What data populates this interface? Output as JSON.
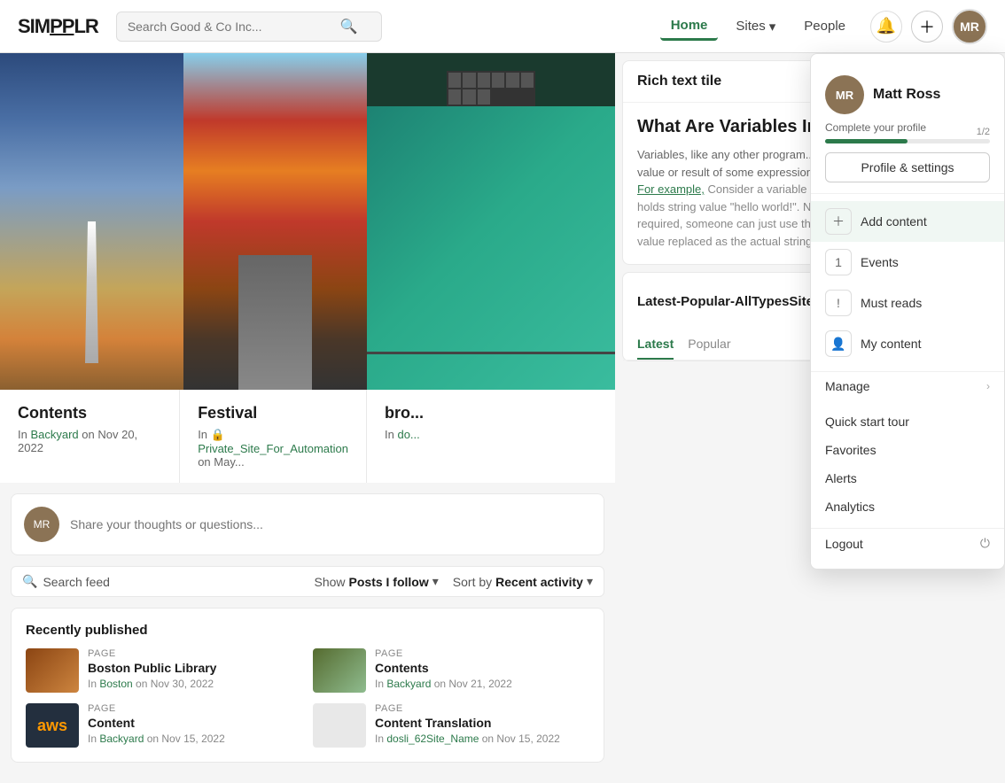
{
  "header": {
    "logo": "SIMPPLR",
    "search_placeholder": "Search Good & Co Inc...",
    "nav": [
      {
        "label": "Home",
        "active": true
      },
      {
        "label": "Sites",
        "has_arrow": true
      },
      {
        "label": "People"
      }
    ],
    "add_label": "+",
    "bell_icon": "🔔"
  },
  "hero_cards": [
    {
      "title": "Contents",
      "meta_prefix": "In",
      "site": "Backyard",
      "date": "on Nov 20, 2022",
      "type": "sky"
    },
    {
      "title": "Festival",
      "meta_prefix": "In",
      "site": "Private_Site_For_Automation",
      "date": "on May...",
      "type": "forest"
    },
    {
      "title": "bro...",
      "meta_prefix": "In",
      "site": "do...",
      "date": "",
      "type": "teal"
    }
  ],
  "post_box": {
    "placeholder": "Share your thoughts or questions..."
  },
  "feed_toolbar": {
    "search_label": "Search feed",
    "show_label": "Show",
    "show_value": "Posts I follow",
    "sort_label": "Sort by",
    "sort_value": "Recent activity"
  },
  "recently_published": {
    "title": "Recently published",
    "items": [
      {
        "thumb": "boston",
        "type": "PAGE",
        "title": "Boston Public Library",
        "site": "Boston",
        "date": "Nov 30, 2022"
      },
      {
        "thumb": "contents",
        "type": "PAGE",
        "title": "Contents",
        "site": "Backyard",
        "date": "Nov 21, 2022"
      },
      {
        "thumb": "aws",
        "type": "PAGE",
        "title": "Content",
        "site": "Backyard",
        "date": "Nov 15, 2022"
      },
      {
        "thumb": "blank",
        "type": "PAGE",
        "title": "Content Translation",
        "site": "dosli_62Site_Name",
        "date": "Nov 15, 2022"
      }
    ]
  },
  "dropdown": {
    "user": {
      "name": "Matt Ross",
      "sub": "Complete your profile",
      "progress": 50,
      "progress_label": "1/2"
    },
    "profile_settings_label": "Profile & settings",
    "add_content_label": "Add content",
    "events_label": "Events",
    "must_reads_label": "Must reads",
    "my_content_label": "My content",
    "manage_label": "Manage",
    "quick_start_label": "Quick start tour",
    "favorites_label": "Favorites",
    "alerts_label": "Alerts",
    "analytics_label": "Analytics",
    "logout_label": "Logout"
  },
  "rich_text": {
    "panel_title": "Rich text tile",
    "article_title": "What Are Variables In",
    "intro": "Variables, like any other program...",
    "body": "placeholders to hold some value or result of some expressions.",
    "example_label": "For example,",
    "example_text": " Consider a variable declaration in C#/Javascript that holds string value \"hello world!\". Now whenever this string is required, someone can just use the name of the variable to get the value replaced as the actual string."
  },
  "latest_panel": {
    "title": "Latest-Popular-AllTypesSiteIFollow",
    "tabs": [
      "Latest",
      "Popular"
    ]
  }
}
